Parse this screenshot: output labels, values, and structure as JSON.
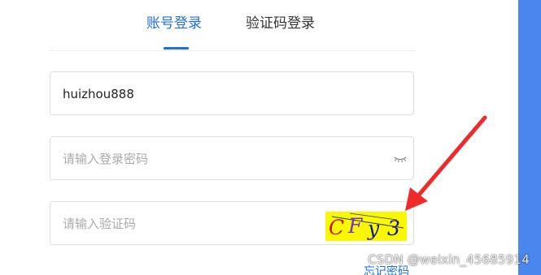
{
  "tabs": {
    "account_login": "账号登录",
    "sms_login": "验证码登录",
    "active": "account_login"
  },
  "form": {
    "username": {
      "value": "huizhou888",
      "placeholder": ""
    },
    "password": {
      "value": "",
      "placeholder": "请输入登录密码",
      "icon": "eye-closed-icon"
    },
    "captcha": {
      "value": "",
      "placeholder": "请输入验证码",
      "image_text": "CFy3"
    }
  },
  "links": {
    "forgot_password": "忘记密码"
  },
  "watermark": "CSDN @weixin_45685914",
  "colors": {
    "accent": "#1f6fe0",
    "tab_inactive": "#333333",
    "scroll_track": "#4a86ee",
    "annotation_arrow": "#ee2a2a",
    "captcha_background": "#f8f800",
    "captcha_c": "#c41a1a",
    "captcha_f": "#7a2fd1",
    "captcha_y3": "#15159a"
  }
}
